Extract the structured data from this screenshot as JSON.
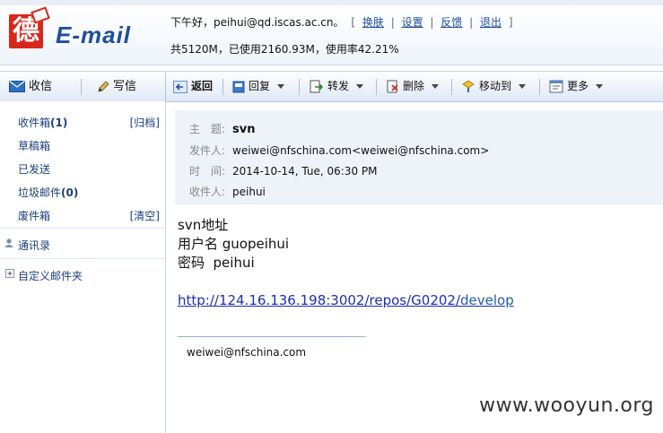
{
  "app": {
    "logo_glyph": "德",
    "logo_text": "E-mail"
  },
  "header": {
    "greeting": "下午好，peihui@qd.iscas.ac.cn。",
    "links": [
      "换肤",
      "设置",
      "反馈",
      "退出"
    ],
    "quota": "共5120M，已使用2160.93M，使用率42.21%"
  },
  "toolbar": {
    "inbox": "收信",
    "compose": "写信",
    "back": "返回",
    "reply": "回复",
    "forward": "转发",
    "delete": "删除",
    "move_to": "移动到",
    "more": "更多"
  },
  "sidebar": {
    "inbox_label": "收件箱",
    "inbox_count": "(1)",
    "inbox_action": "[归档]",
    "drafts": "草稿箱",
    "sent": "已发送",
    "junk_label": "垃圾邮件",
    "junk_count": "(0)",
    "trash": "废件箱",
    "trash_action": "[清空]",
    "contacts": "通讯录",
    "custom_folders": "自定义邮件夹"
  },
  "message": {
    "subject_label": "主　题:",
    "subject": "svn",
    "from_label": "发件人:",
    "from": "weiwei@nfschina.com<weiwei@nfschina.com>",
    "time_label": "时　间:",
    "time": "2014-10-14, Tue, 06:30 PM",
    "to_label": "收件人:",
    "to": "peihui",
    "body_line1": "svn地址",
    "body_line2": "用户名 guopeihui",
    "body_line3": "密码  peihui",
    "link_main": "http://124.16.136.198:3002/repos/G0202/",
    "link_tail": "develop",
    "signature": "weiwei@nfschina.com"
  },
  "watermark": "www.wooyun.org"
}
